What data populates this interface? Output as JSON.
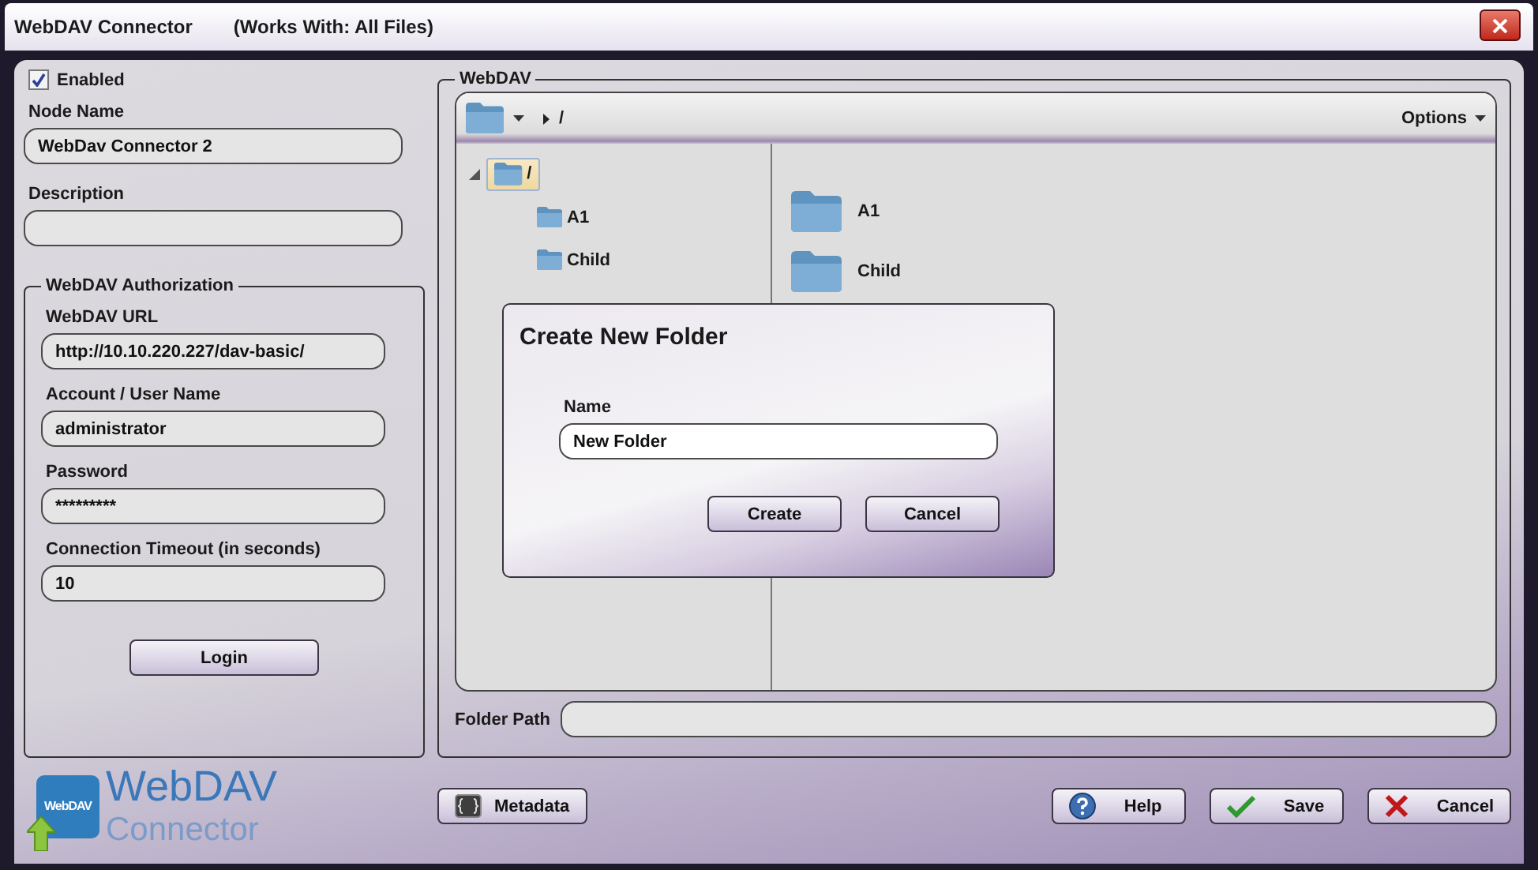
{
  "window": {
    "title": "WebDAV Connector",
    "subtitle": "(Works With: All Files)"
  },
  "enabled": {
    "label": "Enabled",
    "checked": true
  },
  "fields": [
    {
      "label": "Node Name",
      "value": "WebDav Connector 2"
    },
    {
      "label": "Description"
    }
  ],
  "authorization": {
    "title": "WebDAV Authorization",
    "fields": [
      {
        "label": "WebDAV URL",
        "value": "http://10.10.220.227/dav-basic/"
      },
      {
        "label": "Account / User Name",
        "value": "administrator"
      },
      {
        "label": "Password",
        "value": "*********"
      },
      {
        "label": "Connection Timeout (in seconds)",
        "value": "10"
      }
    ],
    "login": "Login"
  },
  "browser": {
    "title": "WebDAV",
    "path": "/",
    "options": "Options",
    "tree": [
      {
        "label": "/",
        "selected": true,
        "expanded": true,
        "children": [
          {
            "label": "A1",
            "selected": false
          },
          {
            "label": "Child",
            "selected": false
          }
        ]
      }
    ],
    "items": [
      {
        "label": "A1"
      },
      {
        "label": "Child"
      }
    ],
    "folder_path": {
      "label": "Folder Path"
    }
  },
  "dialog": {
    "title": "Create New Folder",
    "field_label": "Name",
    "value": "New Folder",
    "buttons": [
      "Create",
      "Cancel"
    ]
  },
  "logo": {
    "badge": "WebDAV",
    "name": "WebDAV",
    "subtitle": "Connector"
  },
  "buttons": [
    {
      "kind": "metadata",
      "label": "Metadata"
    },
    {
      "kind": "help",
      "label": "Help"
    },
    {
      "kind": "save",
      "label": "Save"
    },
    {
      "kind": "cancel",
      "label": "Cancel"
    }
  ]
}
